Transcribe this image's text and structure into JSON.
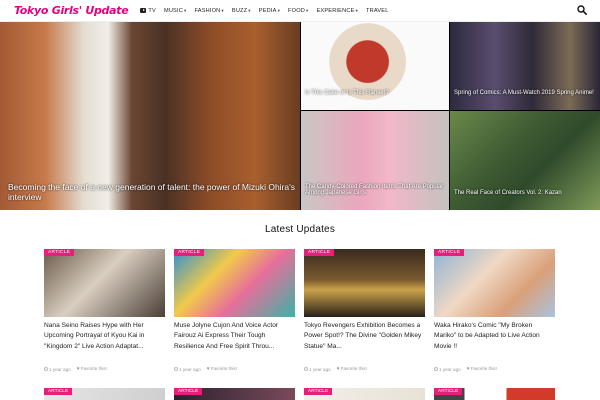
{
  "site": {
    "logo": "Tokyo Girls' Update"
  },
  "nav": [
    {
      "label": "TV",
      "has_caret": false,
      "icon": "tv-icon"
    },
    {
      "label": "MUSIC",
      "has_caret": true
    },
    {
      "label": "FASHION",
      "has_caret": true
    },
    {
      "label": "BUZZ",
      "has_caret": true
    },
    {
      "label": "PEDIA",
      "has_caret": true
    },
    {
      "label": "FOOD",
      "has_caret": true
    },
    {
      "label": "EXPERIENCE",
      "has_caret": true
    },
    {
      "label": "TRAVEL",
      "has_caret": false
    }
  ],
  "caret": "▾",
  "hero": {
    "main": {
      "caption": "Becoming the face of a new generation of talent: the power of Mizuki Ohira's interview"
    },
    "tiles": [
      {
        "caption": "Is This Cake or Is This Ramen?"
      },
      {
        "caption": "Spring of Comics: A Must-Watch 2019 Spring Anime!"
      },
      {
        "caption": "The Candy-Colored Fashion Items That Are Popular Among Japanese Girls"
      },
      {
        "caption": "The Real Face of Creators Vol. 2: Kazan"
      }
    ]
  },
  "latest": {
    "title": "Latest Updates"
  },
  "badge_label": "ARTICLE",
  "cards": [
    {
      "title": "Nana Seino Raises Hype with Her Upcoming Portrayal of Kyou Kai in \"Kingdom 2\" Live Action Adaptat...",
      "time": "1 year ago",
      "fav": "Favorite this!"
    },
    {
      "title": "Muse Jolyne Cujon And Voice Actor Fairouz Ai Express Their Tough Resilience And Free Spirit Throu...",
      "time": "1 year ago",
      "fav": "Favorite this!"
    },
    {
      "title": "Tokyo Revengers Exhibition Becomes a Power Spot!? The Divine \"Golden Mikey Statue\" Ma...",
      "time": "1 year ago",
      "fav": "Favorite this!"
    },
    {
      "title": "Waka Hirako's Comic \"My Broken Mariko\" to be Adapted to Live Action Movie !!",
      "time": "1 year ago",
      "fav": "Favorite this!"
    }
  ],
  "colors": {
    "brand": "#e4007f",
    "badge": "#e91e7a"
  }
}
